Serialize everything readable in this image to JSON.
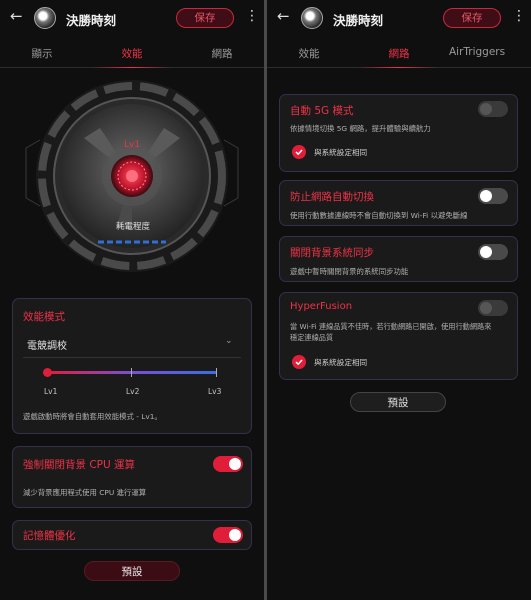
{
  "left": {
    "header": {
      "title": "決勝時刻",
      "save_label": "保存"
    },
    "tabs": [
      "顯示",
      "效能",
      "網路"
    ],
    "active_tab": 1,
    "hero": {
      "level": "Lv1",
      "label": "耗電程度"
    },
    "perf_card": {
      "title": "效能模式",
      "select_value": "電競調校",
      "slider_labels": [
        "Lv1",
        "Lv2",
        "Lv3"
      ],
      "slider_value_level": 1,
      "desc": "遊戲啟動時將會自動套用效能模式 - Lv1。"
    },
    "cpu_card": {
      "title": "強制關閉背景 CPU 運算",
      "desc": "減少背景應用程式使用 CPU 進行運算",
      "on": true
    },
    "mem_card": {
      "title": "記憶體優化",
      "on": true
    },
    "default_label": "預設"
  },
  "right": {
    "header": {
      "title": "決勝時刻",
      "save_label": "保存"
    },
    "tabs": [
      "效能",
      "網路",
      "AirTriggers"
    ],
    "active_tab": 1,
    "cards": {
      "auto5g": {
        "title": "自動 5G 模式",
        "desc": "依據情境切換 5G 網路，提升體驗與續航力",
        "check": "與系統設定相同",
        "enabled": false
      },
      "no_switch": {
        "title": "防止網路自動切換",
        "desc": "使用行動數據連線時不會自動切換到 Wi-Fi 以避免斷線",
        "on": false
      },
      "bg_sync": {
        "title": "關閉背景系統同步",
        "desc": "遊戲中暫時關閉背景的系統同步功能",
        "on": false
      },
      "hyperfusion": {
        "title": "HyperFusion",
        "desc1": "當 Wi-Fi 連線品質不佳時，若行動網路已開啟，使用行動網路來",
        "desc2": "穩定連線品質",
        "check": "與系統設定相同",
        "enabled": false
      }
    },
    "default_label": "預設"
  },
  "colors": {
    "accent": "#ef3247",
    "toggle_on": "#e01e3a",
    "card_border": "#352f4c"
  },
  "icons": {
    "back": "arrow-left-icon",
    "more": "more-vert-icon",
    "check": "check-circle-icon",
    "chevron": "chevron-down-icon"
  }
}
